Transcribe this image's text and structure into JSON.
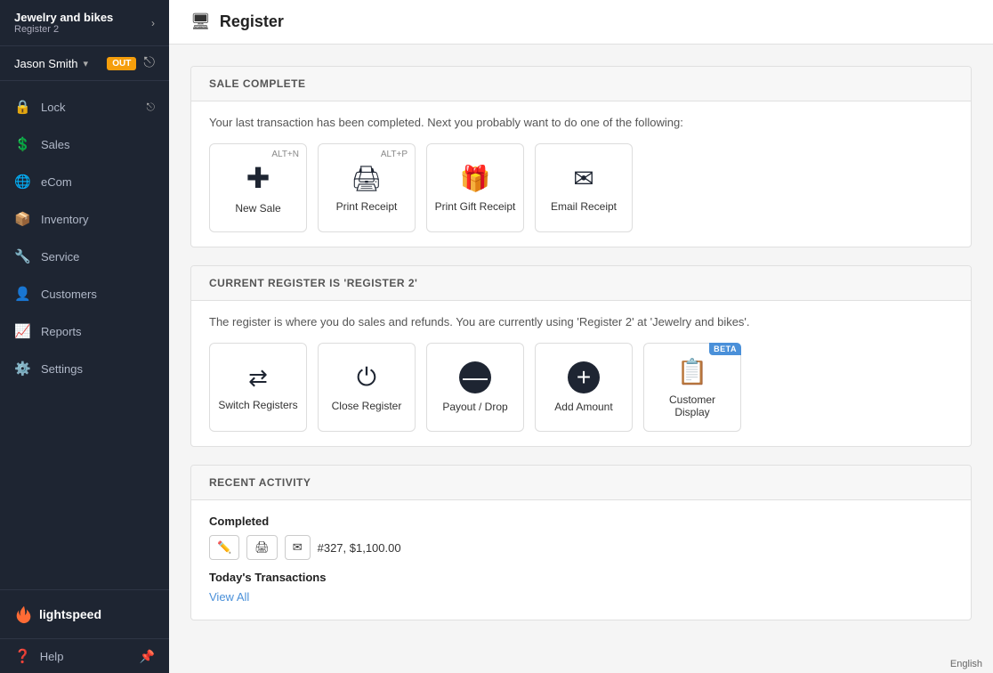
{
  "sidebar": {
    "brand_name": "Jewelry and bikes",
    "brand_sub": "Register 2",
    "chevron": "›",
    "user_name": "Jason Smith",
    "out_badge": "OUT",
    "nav_items": [
      {
        "label": "Lock",
        "icon": "🔒",
        "id": "lock"
      },
      {
        "label": "Sales",
        "icon": "💲",
        "id": "sales"
      },
      {
        "label": "eCom",
        "icon": "🌐",
        "id": "ecom"
      },
      {
        "label": "Inventory",
        "icon": "📦",
        "id": "inventory"
      },
      {
        "label": "Service",
        "icon": "🔧",
        "id": "service"
      },
      {
        "label": "Customers",
        "icon": "👤",
        "id": "customers"
      },
      {
        "label": "Reports",
        "icon": "📊",
        "id": "reports"
      },
      {
        "label": "Settings",
        "icon": "⚙️",
        "id": "settings"
      }
    ],
    "logo_text": "lightspeed",
    "help_label": "Help"
  },
  "header": {
    "icon": "🖥",
    "title": "Register"
  },
  "sale_complete": {
    "section_title": "SALE COMPLETE",
    "description": "Your last transaction has been completed. Next you probably want to do one of the following:",
    "cards": [
      {
        "id": "new-sale",
        "shortcut": "ALT+N",
        "icon": "➕",
        "label": "New Sale"
      },
      {
        "id": "print-receipt",
        "shortcut": "ALT+P",
        "icon": "🖨",
        "label": "Print Receipt"
      },
      {
        "id": "print-gift-receipt",
        "shortcut": "",
        "icon": "🎁",
        "label": "Print Gift Receipt"
      },
      {
        "id": "email-receipt",
        "shortcut": "",
        "icon": "✉",
        "label": "Email Receipt"
      }
    ]
  },
  "current_register": {
    "section_title": "CURRENT REGISTER IS 'REGISTER 2'",
    "description": "The register is where you do sales and refunds. You are currently using 'Register 2'  at 'Jewelry and bikes'.",
    "cards": [
      {
        "id": "switch-registers",
        "shortcut": "",
        "icon": "⇄",
        "label": "Switch Registers",
        "beta": false
      },
      {
        "id": "close-register",
        "shortcut": "",
        "icon": "⏻",
        "label": "Close Register",
        "beta": false
      },
      {
        "id": "payout-drop",
        "shortcut": "",
        "icon": "➖",
        "label": "Payout / Drop",
        "beta": false
      },
      {
        "id": "add-amount",
        "shortcut": "",
        "icon": "➕",
        "label": "Add Amount",
        "beta": false
      },
      {
        "id": "customer-display",
        "shortcut": "",
        "icon": "📋",
        "label": "Customer Display",
        "beta": true
      }
    ]
  },
  "recent_activity": {
    "section_title": "RECENT ACTIVITY",
    "completed_label": "Completed",
    "transaction_text": "#327, $1,100.00",
    "transactions_title": "Today's Transactions",
    "view_all_label": "View All"
  },
  "footer": {
    "language": "English"
  }
}
